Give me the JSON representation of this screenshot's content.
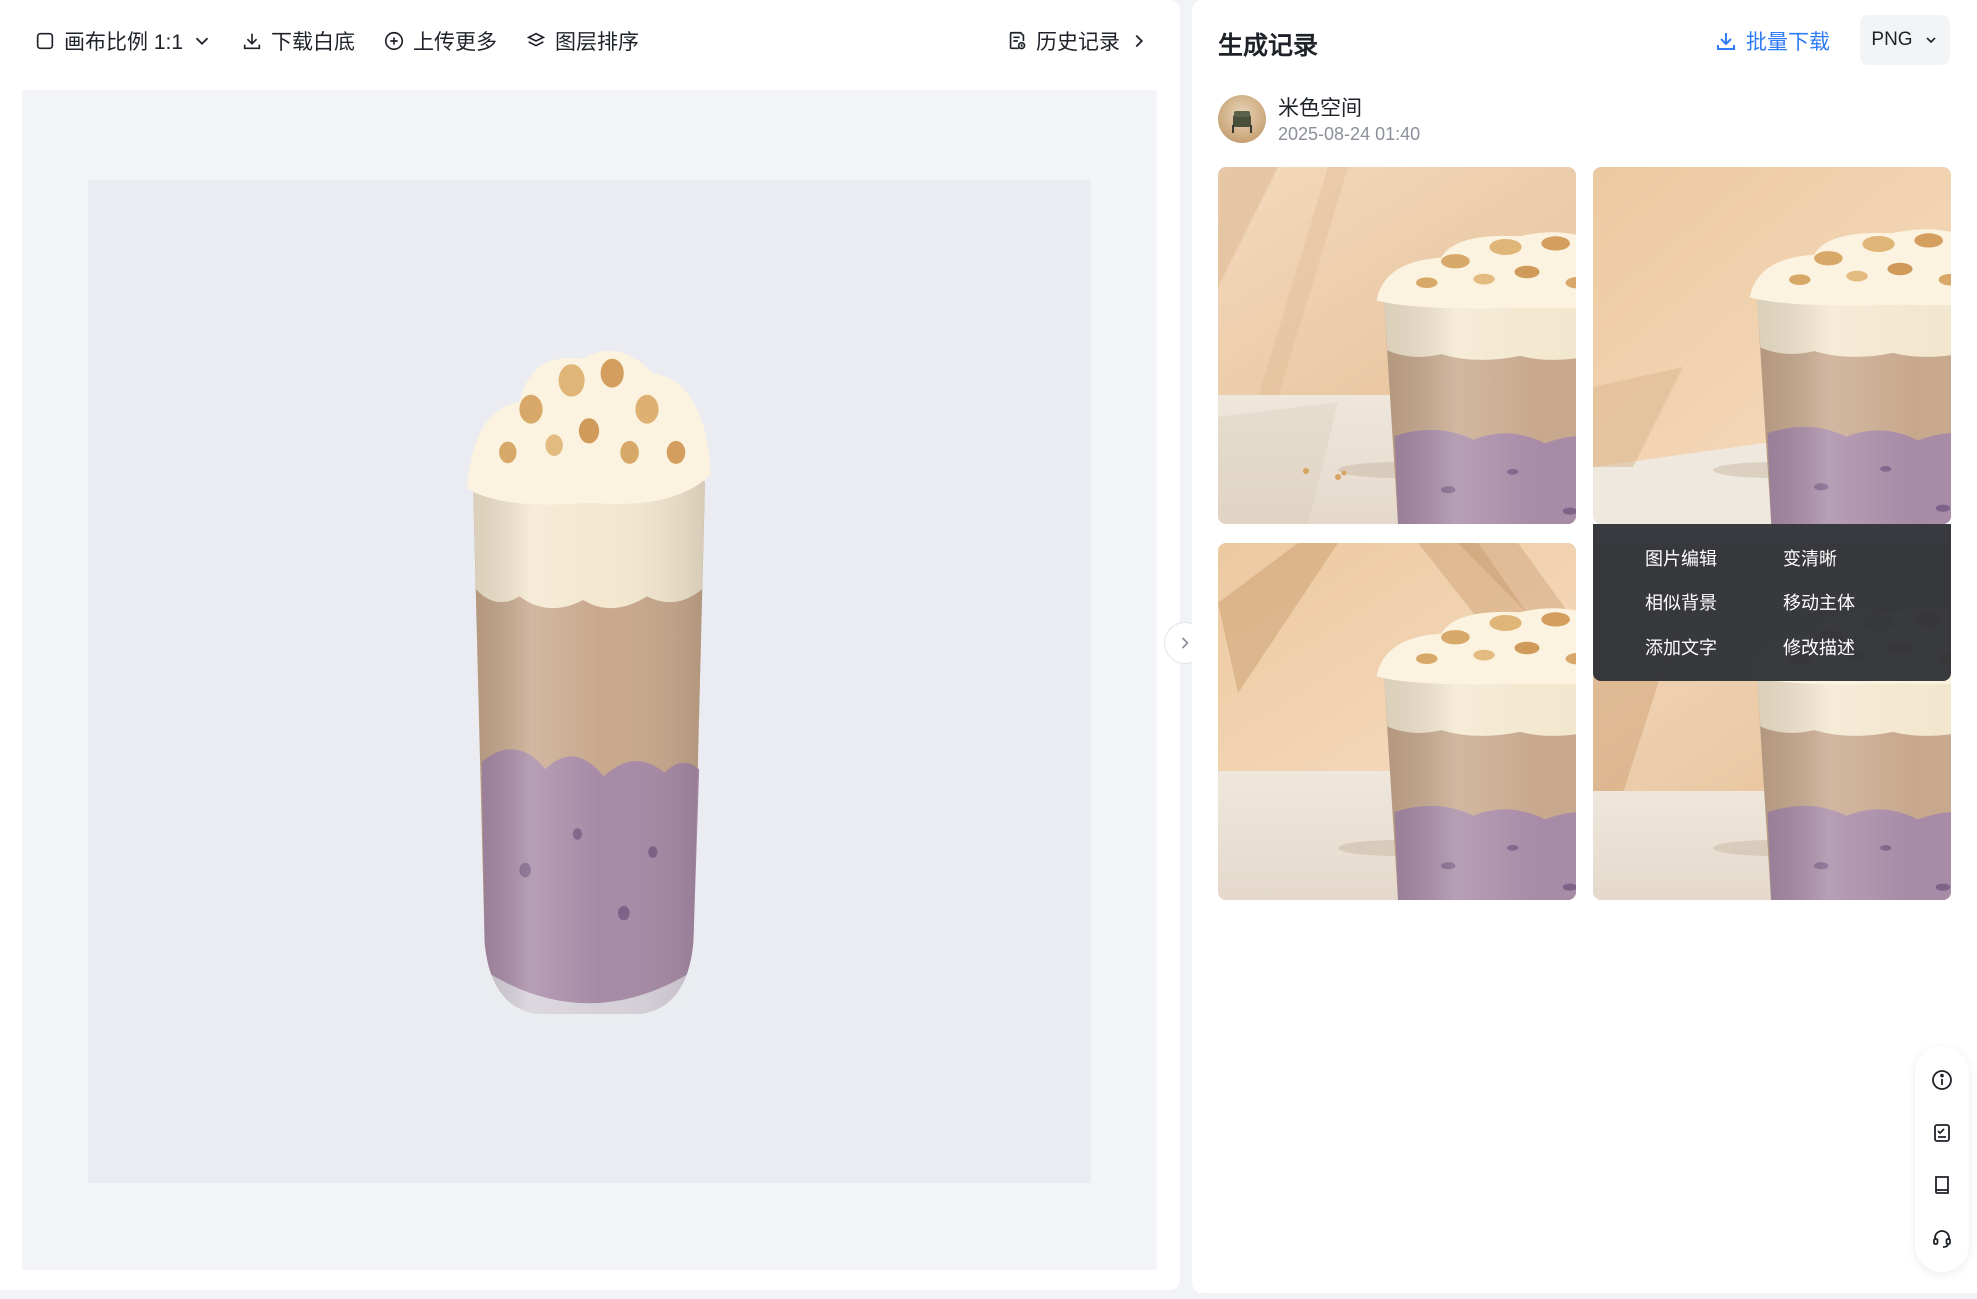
{
  "toolbar": {
    "canvas_ratio": "画布比例 1:1",
    "download_white": "下载白底",
    "upload_more": "上传更多",
    "layer_order": "图层排序",
    "history": "历史记录"
  },
  "panel": {
    "title": "生成记录",
    "batch_download": "批量下载",
    "format": "PNG",
    "user": {
      "name": "米色空间",
      "time": "2025-08-24 01:40"
    }
  },
  "hover_menu": {
    "items": [
      "图片编辑",
      "变清晰",
      "相似背景",
      "移动主体",
      "添加文字",
      "修改描述"
    ]
  },
  "icons": {
    "side": [
      "info-icon",
      "checklist-icon",
      "book-icon",
      "headset-icon"
    ]
  },
  "colors": {
    "accent": "#2f7cf6",
    "menu_bg": "#323439"
  }
}
